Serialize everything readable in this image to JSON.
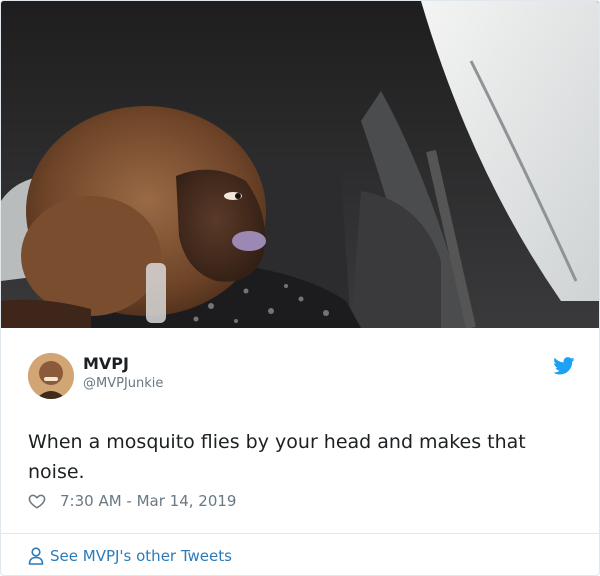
{
  "tweet": {
    "author_name": "MVPJ",
    "author_handle": "@MVPJunkie",
    "text": "When a mosquito flies by your head and makes that noise.",
    "timestamp": "7:30 AM - Mar 14, 2019",
    "footer_link": "See MVPJ's other Tweets"
  },
  "icons": {
    "brand": "twitter-bird-icon",
    "like": "heart-icon",
    "profile": "person-icon"
  },
  "colors": {
    "brand_blue": "#1da1f2",
    "link_blue": "#2b7bb9",
    "muted_text": "#697882",
    "border": "#e1e8ed"
  }
}
